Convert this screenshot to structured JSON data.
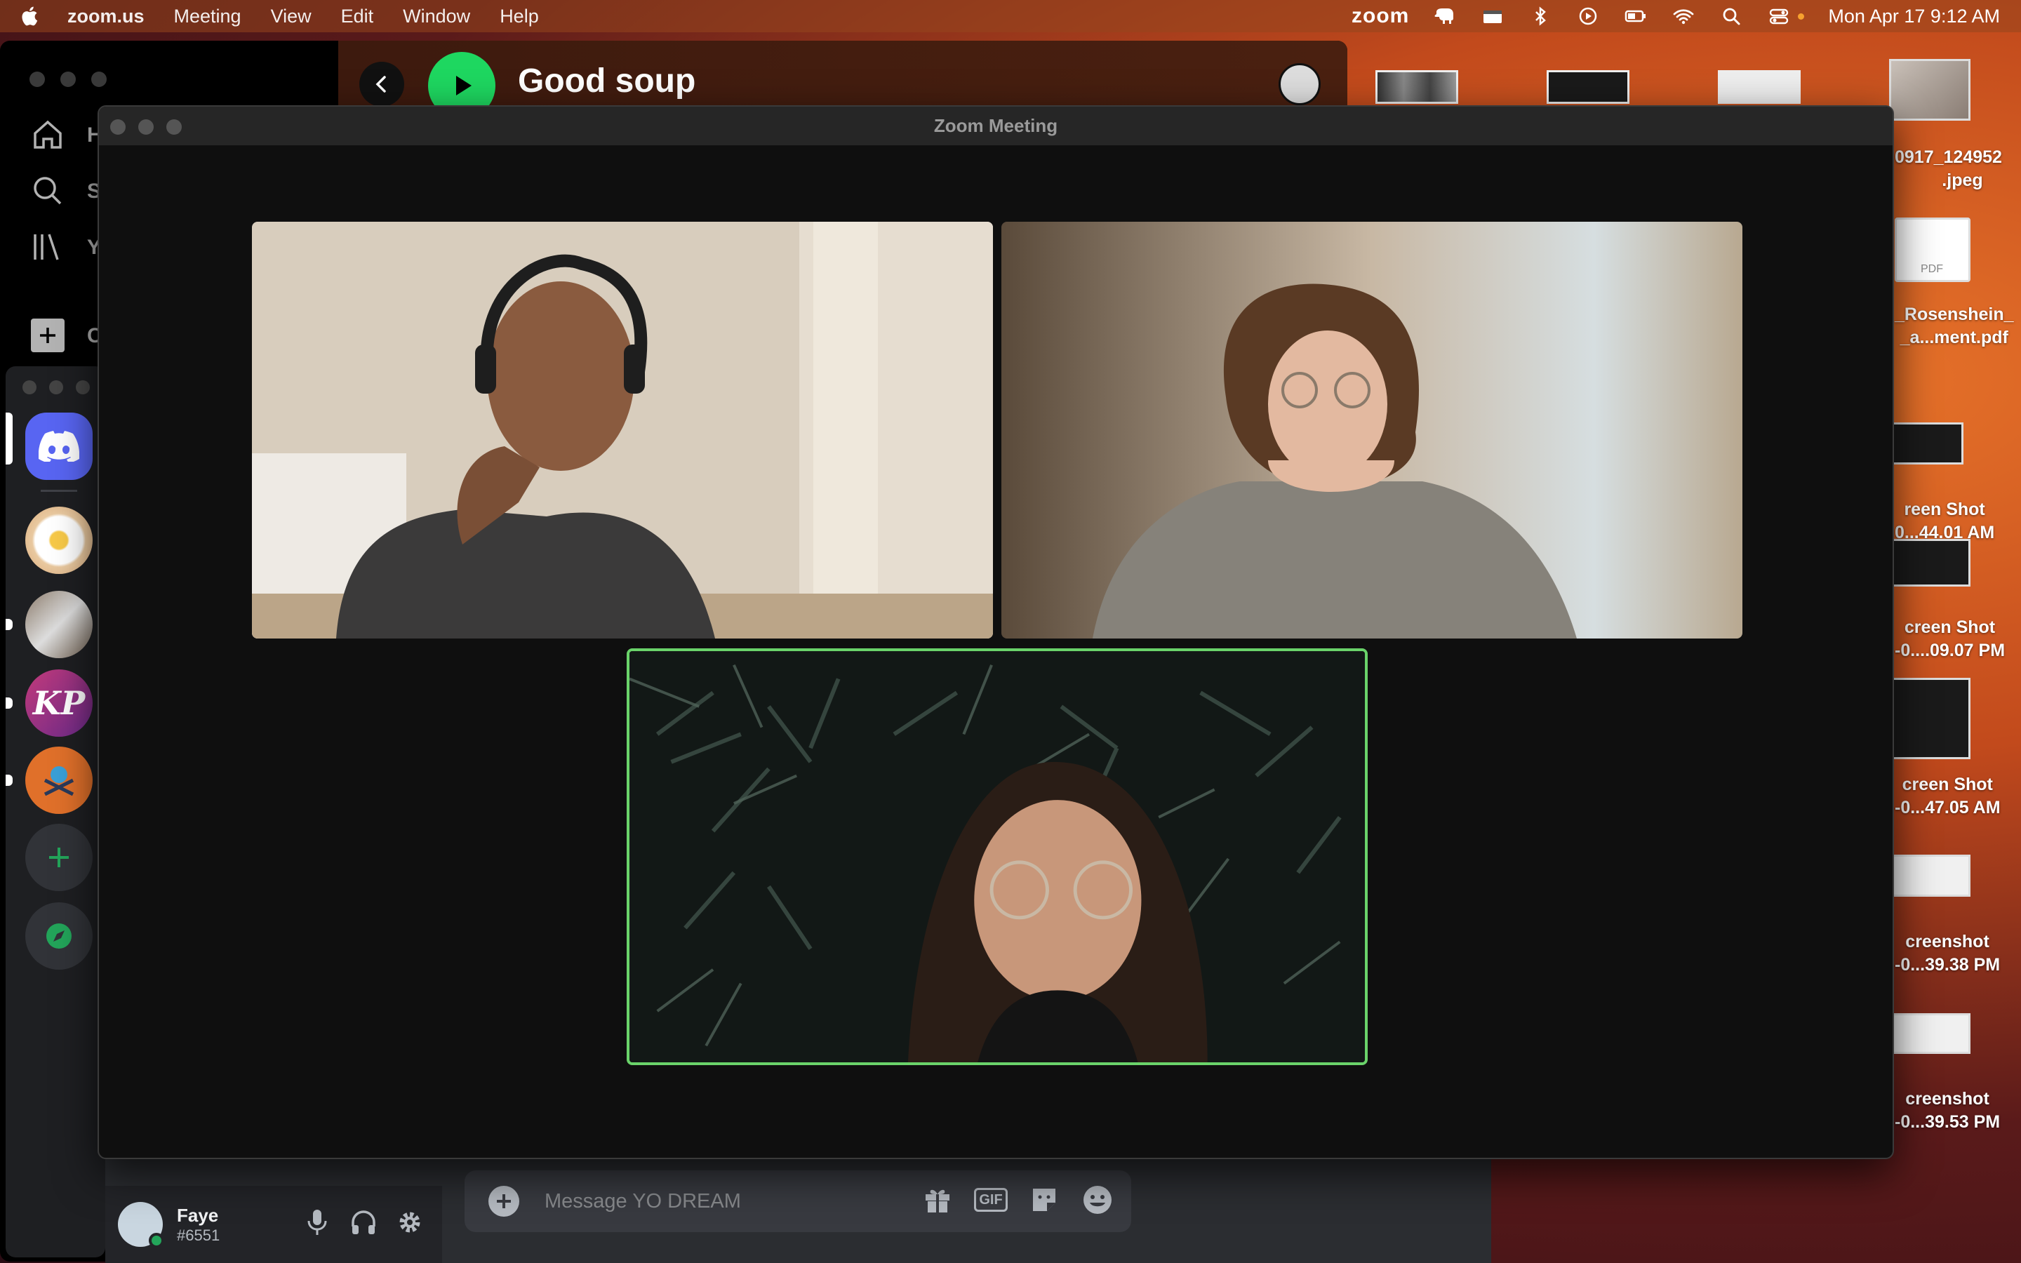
{
  "menubar": {
    "app_name": "zoom.us",
    "menus": [
      "Meeting",
      "View",
      "Edit",
      "Window",
      "Help"
    ],
    "brand": "zoom",
    "datetime": "Mon Apr 17  9:12 AM"
  },
  "spotify": {
    "playlist_title": "Good soup",
    "nav_letters": [
      "H",
      "S",
      "Y",
      "C"
    ]
  },
  "zoom": {
    "window_title": "Zoom Meeting"
  },
  "discord": {
    "user": {
      "name": "Faye",
      "tag": "#6551"
    },
    "message_placeholder": "Message YO DREAM",
    "gif_label": "GIF"
  },
  "desktop": {
    "files": [
      {
        "label1": "0917_124952",
        "label2": ".jpeg"
      },
      {
        "label1": "_Rosenshein_",
        "label2": "_a...ment.pdf",
        "badge": "PDF"
      },
      {
        "label1": "reen Shot",
        "label2": "0...44.01 AM"
      },
      {
        "label1": "creen Shot",
        "label2": "-0....09.07 PM"
      },
      {
        "label1": "creen Shot",
        "label2": "-0...47.05 AM"
      },
      {
        "label1": "creenshot",
        "label2": "-0...39.38 PM"
      },
      {
        "label1": "creenshot",
        "label2": "-0...39.53 PM"
      }
    ]
  },
  "colors": {
    "zoom_active_border": "#6ad36a",
    "spotify_green": "#1ed760",
    "discord_blurple": "#5865f2",
    "online_green": "#23a55a"
  }
}
